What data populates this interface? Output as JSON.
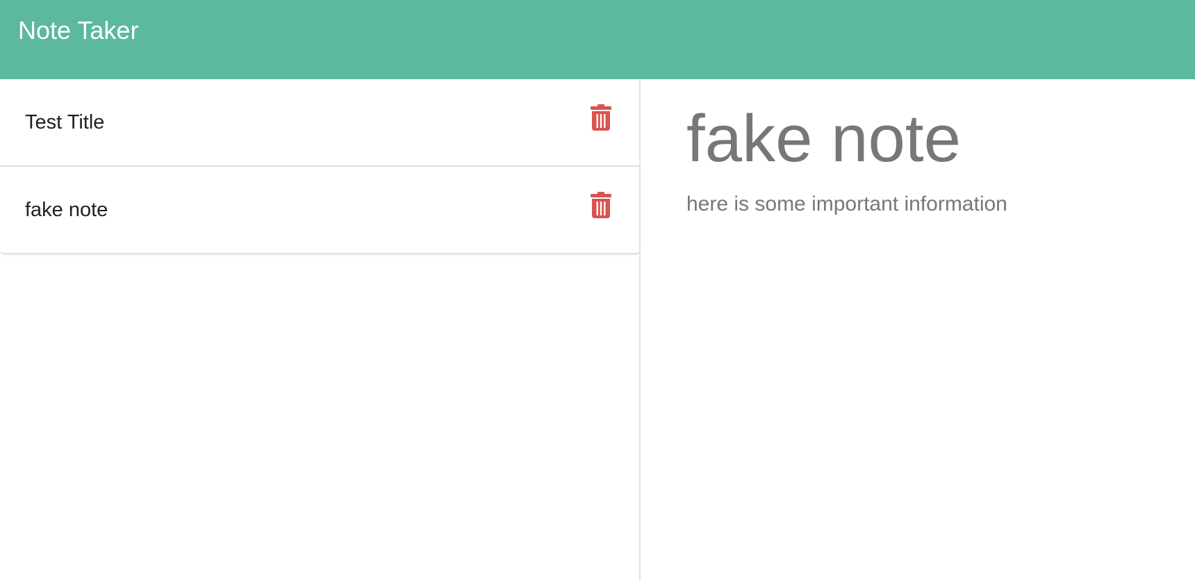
{
  "navbar": {
    "brand": "Note Taker",
    "background_color": "#5cb99d"
  },
  "sidebar": {
    "notes": [
      {
        "title": "Test Title",
        "delete_icon": "trash-icon"
      },
      {
        "title": "fake note",
        "delete_icon": "trash-icon"
      }
    ],
    "delete_color": "#d9534f"
  },
  "detail": {
    "title": "fake note",
    "text": "here is some important information"
  }
}
